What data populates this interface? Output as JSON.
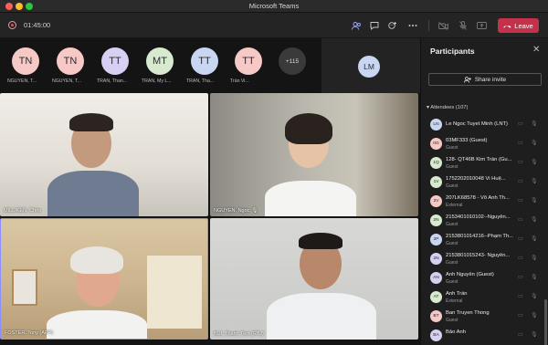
{
  "window": {
    "title": "Microsoft Teams"
  },
  "toolbar": {
    "timer": "01:45:00",
    "leave_label": "Leave"
  },
  "roster": [
    {
      "initials": "TN",
      "name": "NGUYEN, T...",
      "color": "#f7c9c6"
    },
    {
      "initials": "TN",
      "name": "NGUYEN, T...",
      "color": "#f7c9c6"
    },
    {
      "initials": "TT",
      "name": "TRAN, Than...",
      "color": "#d8d0f2"
    },
    {
      "initials": "MT",
      "name": "TRAN, My L...",
      "color": "#d7ead0"
    },
    {
      "initials": "TT",
      "name": "TRAN, Tha...",
      "color": "#c9d6f2"
    },
    {
      "initials": "TT",
      "name": "Trần Vi...",
      "color": "#f7c9c6"
    }
  ],
  "more_count": "+115",
  "spotlight": {
    "initials": "LM"
  },
  "tiles": [
    {
      "name": "MILLIKEN, Chris"
    },
    {
      "name": "NGUYEN, Ngoc"
    },
    {
      "name": "FOSTER, Tony (APP)"
    },
    {
      "name": "BUI, Thanh Tien (RTJ)"
    }
  ],
  "panel": {
    "title": "Participants",
    "share_label": "Share invite",
    "attendees_label": "Attendees (107)",
    "participants": [
      {
        "initials": "LN",
        "name": "Le Ngoc Tuyet Minh (LNT)",
        "sub": "",
        "color": "#c9d6f2"
      },
      {
        "initials": "0G",
        "name": "03MF333 (Guest)",
        "sub": "Guest",
        "color": "#f7c9c6"
      },
      {
        "initials": "1Q",
        "name": "128- QT46B Kim Trần (Gu...",
        "sub": "Guest",
        "color": "#d7ead0"
      },
      {
        "initials": "1V",
        "name": "1752202010048 Vi Huệ...",
        "sub": "Guest",
        "color": "#d7ead0"
      },
      {
        "initials": "2V",
        "name": "207LK68578 - Võ Anh Th...",
        "sub": "External",
        "color": "#f7c9c6"
      },
      {
        "initials": "2N",
        "name": "2153401010102--Nguyễn...",
        "sub": "Guest",
        "color": "#d7ead0"
      },
      {
        "initials": "2P",
        "name": "2153801014216--Phạm Th...",
        "sub": "Guest",
        "color": "#c9d6f2"
      },
      {
        "initials": "2N",
        "name": "2153801015243- Nguyễn...",
        "sub": "Guest",
        "color": "#d8d0f2"
      },
      {
        "initials": "AN",
        "name": "Anh Nguyễn (Guest)",
        "sub": "Guest",
        "color": "#d8d0f2"
      },
      {
        "initials": "AT",
        "name": "Anh Trần",
        "sub": "External",
        "color": "#d7ead0"
      },
      {
        "initials": "BT",
        "name": "Ban Truyen Thong",
        "sub": "Guest",
        "color": "#f7c9c6"
      },
      {
        "initials": "BA",
        "name": "Bảo Anh",
        "sub": "",
        "color": "#d8d0f2"
      }
    ]
  },
  "colors": {
    "accent": "#9aa6ff",
    "leave": "#c4314b"
  }
}
